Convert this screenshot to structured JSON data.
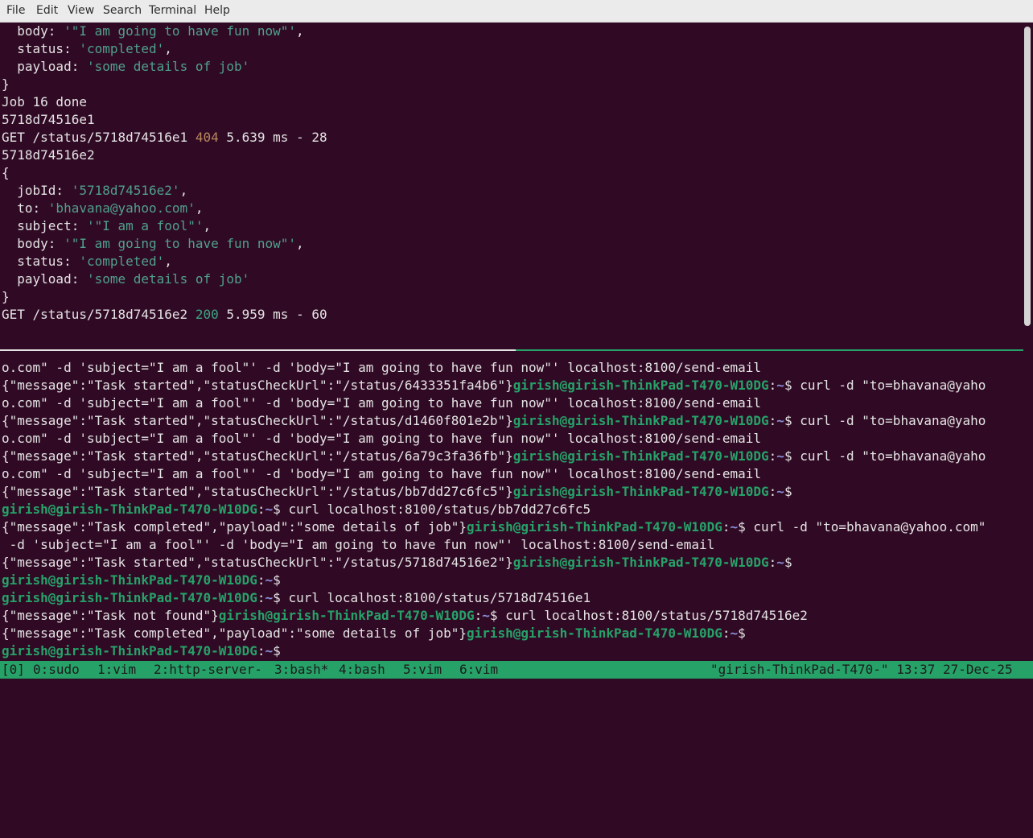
{
  "menu": {
    "file": "File",
    "edit": "Edit",
    "view": "View",
    "search": "Search",
    "terminal": "Terminal",
    "help": "Help"
  },
  "top_pane": {
    "l1_key": "  body: ",
    "l1_val": "'\"I am going to have fun now\"'",
    "l1_end": ",",
    "l2_key": "  status: ",
    "l2_val": "'completed'",
    "l2_end": ",",
    "l3_key": "  payload: ",
    "l3_val": "'some details of job'",
    "l4": "}",
    "l5": "Job 16 done",
    "l6": "5718d74516e1",
    "l7_pre": "GET /status/5718d74516e1 ",
    "l7_code": "404",
    "l7_post": " 5.639 ms - 28",
    "l8": "5718d74516e2",
    "l9": "{",
    "l10_key": "  jobId: ",
    "l10_val": "'5718d74516e2'",
    "l10_end": ",",
    "l11_key": "  to: ",
    "l11_val": "'bhavana@yahoo.com'",
    "l11_end": ",",
    "l12_key": "  subject: ",
    "l12_val": "'\"I am a fool\"'",
    "l12_end": ",",
    "l13_key": "  body: ",
    "l13_val": "'\"I am going to have fun now\"'",
    "l13_end": ",",
    "l14_key": "  status: ",
    "l14_val": "'completed'",
    "l14_end": ",",
    "l15_key": "  payload: ",
    "l15_val": "'some details of job'",
    "l16": "}",
    "l17_pre": "GET /status/5718d74516e2 ",
    "l17_code": "200",
    "l17_post": " 5.959 ms - 60"
  },
  "bottom_pane": {
    "prompt_user": "girish@girish-ThinkPad-T470-W10DG",
    "prompt_colon": ":",
    "prompt_path": "~",
    "prompt_dollar": "$",
    "b1": "o.com\" -d 'subject=\"I am a fool\"' -d 'body=\"I am going to have fun now\"' localhost:8100/send-email",
    "b2_pre": "{\"message\":\"Task started\",\"statusCheckUrl\":\"/status/6433351fa4b6\"}",
    "b2_cmd": " curl -d \"to=bhavana@yaho",
    "b3": "o.com\" -d 'subject=\"I am a fool\"' -d 'body=\"I am going to have fun now\"' localhost:8100/send-email",
    "b4_pre": "{\"message\":\"Task started\",\"statusCheckUrl\":\"/status/d1460f801e2b\"}",
    "b4_cmd": " curl -d \"to=bhavana@yaho",
    "b5": "o.com\" -d 'subject=\"I am a fool\"' -d 'body=\"I am going to have fun now\"' localhost:8100/send-email",
    "b6_pre": "{\"message\":\"Task started\",\"statusCheckUrl\":\"/status/6a79c3fa36fb\"}",
    "b6_cmd": " curl -d \"to=bhavana@yaho",
    "b7": "o.com\" -d 'subject=\"I am a fool\"' -d 'body=\"I am going to have fun now\"' localhost:8100/send-email",
    "b8_pre": "{\"message\":\"Task started\",\"statusCheckUrl\":\"/status/bb7dd27c6fc5\"}",
    "b9_cmd": " curl localhost:8100/status/bb7dd27c6fc5",
    "b10_pre": "{\"message\":\"Task completed\",\"payload\":\"some details of job\"}",
    "b10_cmd": " curl -d \"to=bhavana@yahoo.com\"",
    "b11": " -d 'subject=\"I am a fool\"' -d 'body=\"I am going to have fun now\"' localhost:8100/send-email",
    "b12_pre": "{\"message\":\"Task started\",\"statusCheckUrl\":\"/status/5718d74516e2\"}",
    "b14_cmd": " curl localhost:8100/status/5718d74516e1",
    "b15_pre": "{\"message\":\"Task not found\"}",
    "b15_cmd": " curl localhost:8100/status/5718d74516e2",
    "b16_pre": "{\"message\":\"Task completed\",\"payload\":\"some details of job\"}"
  },
  "statusbar": {
    "session": "[0]",
    "w0": "0:sudo",
    "w1": "1:vim",
    "w2": "2:http-server-",
    "w3": "3:bash*",
    "w4": "4:bash",
    "w5": "5:vim",
    "w6": "6:vim",
    "right": "\"girish-ThinkPad-T470-\" 13:37 27-Dec-25"
  },
  "colors": {
    "background": "#300a24",
    "string": "#4fa08b",
    "prompt": "#26a269",
    "path": "#8a8fdc",
    "status_bar": "#26a269"
  }
}
